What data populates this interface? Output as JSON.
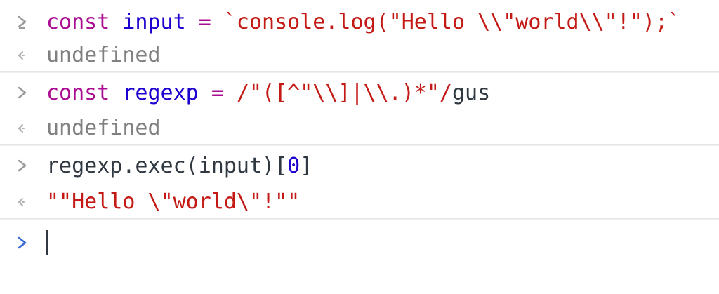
{
  "console": {
    "entries": [
      {
        "type": "input",
        "tokens": {
          "kw": "const",
          "name": "input",
          "op": "=",
          "value": "`console.log(\"Hello \\\\\"world\\\\\"!\");`"
        }
      },
      {
        "type": "output",
        "text": "undefined"
      },
      {
        "type": "input",
        "tokens": {
          "kw": "const",
          "name": "regexp",
          "op": "=",
          "value": "/\"([^\"\\\\]|\\\\.)*\"/",
          "flags": "gus"
        }
      },
      {
        "type": "output",
        "text": "undefined"
      },
      {
        "type": "input",
        "tokens": {
          "pre": "regexp.exec(input)[",
          "num": "0",
          "post": "]"
        }
      },
      {
        "type": "output",
        "text": "\"\"Hello \\\"world\\\"!\"\""
      }
    ],
    "prompt_value": ""
  },
  "colors": {
    "keyword": "#aa0d91",
    "variable": "#1c00cf",
    "string": "#c41a16",
    "muted": "#808080",
    "prompt_active": "#3a6ad6",
    "prompt": "#a0a0a0"
  },
  "icons": {
    "input_prompt": "chevron-right-icon",
    "output_arrow": "return-arrow-icon"
  }
}
